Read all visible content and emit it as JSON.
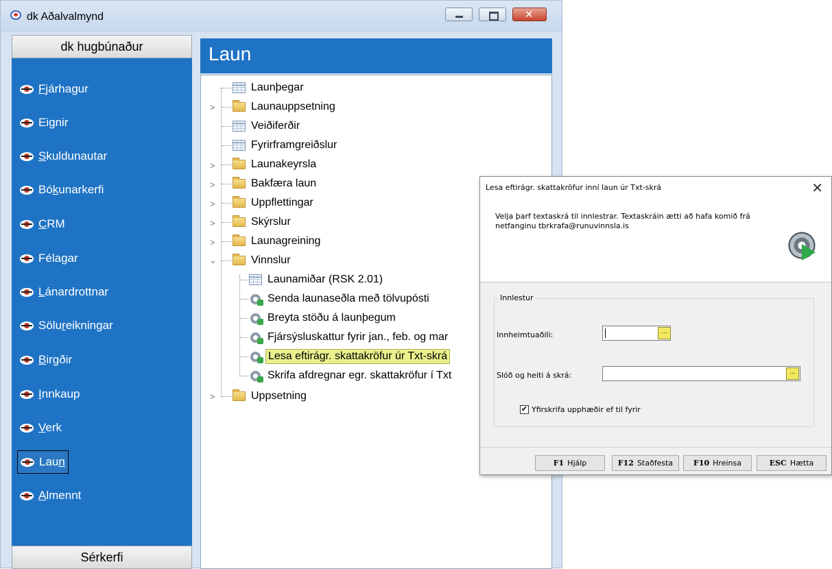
{
  "window": {
    "title": "dk Aðalvalmynd"
  },
  "sidebar": {
    "header": "dk hugbúnaður",
    "footer": "Sérkerfi",
    "items": [
      {
        "before": "",
        "ul": "F",
        "after": "járhagur"
      },
      {
        "before": "Eignir",
        "ul": "",
        "after": ""
      },
      {
        "before": "",
        "ul": "S",
        "after": "kuldunautar"
      },
      {
        "before": "Bó",
        "ul": "k",
        "after": "unarkerfi"
      },
      {
        "before": "",
        "ul": "C",
        "after": "RM"
      },
      {
        "before": "Féla",
        "ul": "g",
        "after": "ar"
      },
      {
        "before": "",
        "ul": "L",
        "after": "ánardrottnar"
      },
      {
        "before": "Sölu",
        "ul": "r",
        "after": "eikningar"
      },
      {
        "before": "",
        "ul": "B",
        "after": "irgðir"
      },
      {
        "before": "",
        "ul": "I",
        "after": "nnkaup"
      },
      {
        "before": "",
        "ul": "V",
        "after": "erk"
      },
      {
        "before": "Lau",
        "ul": "n",
        "after": ""
      },
      {
        "before": "",
        "ul": "A",
        "after": "lmennt"
      }
    ]
  },
  "panel": {
    "title": "Laun"
  },
  "tree": {
    "items": [
      {
        "label": "Launþegar",
        "icon": "table"
      },
      {
        "label": "Launauppsetning",
        "icon": "folder"
      },
      {
        "label": "Veiðiferðir",
        "icon": "table"
      },
      {
        "label": "Fyrirframgreiðslur",
        "icon": "table"
      },
      {
        "label": "Launakeyrsla",
        "icon": "folder"
      },
      {
        "label": "Bakfæra laun",
        "icon": "folder"
      },
      {
        "label": "Uppflettingar",
        "icon": "folder"
      },
      {
        "label": "Skýrslur",
        "icon": "folder"
      },
      {
        "label": "Launagreining",
        "icon": "folder"
      },
      {
        "label": "Vinnslur",
        "icon": "folder"
      },
      {
        "label": "Launamiðar (RSK 2.01)",
        "icon": "table"
      },
      {
        "label": "Senda launaseðla með tölvupósti",
        "icon": "gear"
      },
      {
        "label": "Breyta stöðu á launþegum",
        "icon": "gear"
      },
      {
        "label": "Fjársýsluskattur fyrir jan., feb. og mar",
        "icon": "gear"
      },
      {
        "label": "Lesa eftirágr. skattakröfur úr Txt-skrá",
        "icon": "gear"
      },
      {
        "label": "Skrifa afdregnar egr. skattakröfur í Txt",
        "icon": "gear"
      },
      {
        "label": "Uppsetning",
        "icon": "folder"
      }
    ]
  },
  "dialog": {
    "title": "Lesa eftirágr. skattakröfur inní laun úr Txt-skrá",
    "close": "✕",
    "description": "Velja þarf textaskrá til innlestrar.  Textaskráin ætti að hafa komið frá netfanginu tbrkrafa@runuvinnsla.is",
    "group_label": "Innlestur",
    "field1_label": "Innheimtuaðili:",
    "field1_value": "",
    "field2_label": "Slóð og heiti á skrá:",
    "field2_value": "",
    "lookup": "...",
    "checkbox_label": "Yfirskrifa upphæðir ef til fyrir",
    "checkbox_mark": "✔",
    "buttons": [
      {
        "key": "F1",
        "label": "Hjálp"
      },
      {
        "key": "F12",
        "label": "Staðfesta"
      },
      {
        "key": "F10",
        "label": "Hreinsa"
      },
      {
        "key": "ESC",
        "label": "Hætta"
      }
    ]
  },
  "colors": {
    "accent_blue": "#1f73c4",
    "selection": "#e9f08c",
    "lookup_button": "#f2e85d"
  }
}
